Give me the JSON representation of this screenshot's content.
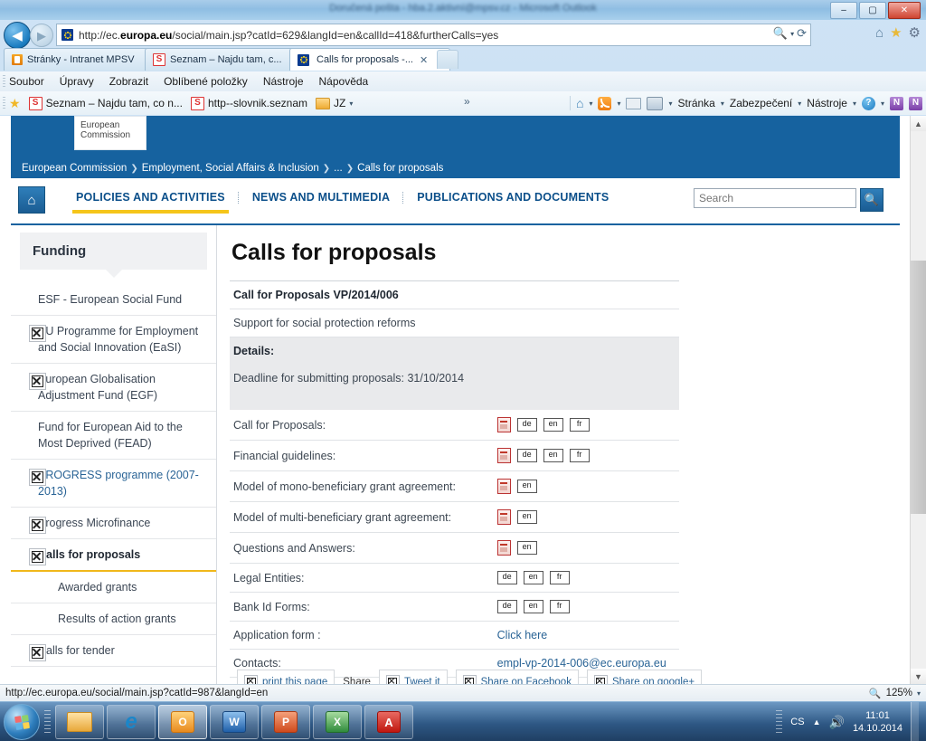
{
  "window": {
    "title": "Doručená pošta - hba.2.aktivní@mpsv.cz - Microsoft Outlook",
    "minimize": "–",
    "maximize": "▢",
    "close": "✕"
  },
  "browser": {
    "back_icon": "back-arrow",
    "forward_icon": "forward-arrow",
    "url": "http://ec.europa.eu/social/main.jsp?catId=629&langId=en&callId=418&furtherCalls=yes",
    "url_prefix": "http://ec.",
    "url_domain": "europa.eu",
    "url_suffix": "/social/main.jsp?catId=629&langId=en&callId=418&furtherCalls=yes",
    "search_addr_icon": "search-icon",
    "refresh_icon": "refresh-icon",
    "home_icon": "home-icon",
    "favorites_icon": "star-icon",
    "settings_icon": "gear-icon",
    "tabs": [
      {
        "label": "Stránky - Intranet MPSV",
        "favicon": "mpsv-icon",
        "active": false
      },
      {
        "label": "Seznam – Najdu tam, c...",
        "favicon": "seznam-icon",
        "active": false
      },
      {
        "label": "Calls for proposals -...",
        "favicon": "eu-icon",
        "active": true,
        "close": "✕"
      }
    ],
    "menus": [
      "Soubor",
      "Úpravy",
      "Zobrazit",
      "Oblíbené položky",
      "Nástroje",
      "Nápověda"
    ],
    "favorites_bar": {
      "star_icon": "star-icon",
      "items": [
        {
          "label": "Seznam – Najdu tam, co n...",
          "icon": "seznam-icon"
        },
        {
          "label": "http--slovnik.seznam",
          "icon": "seznam-icon"
        },
        {
          "label": "JZ",
          "icon": "folder-icon",
          "caret": "▾"
        }
      ],
      "overflow": "»"
    },
    "command_bar": {
      "home_icon": "home-icon",
      "feeds_icon": "rss-icon",
      "mail_icon": "mail-icon",
      "print_icon": "printer-icon",
      "items": [
        "Stránka",
        "Zabezpečení",
        "Nástroje"
      ],
      "help_icon": "help-icon",
      "onenote_icon": "onenote-icon",
      "onenote_linked_icon": "onenote-linked-icon",
      "caret": "▾"
    }
  },
  "site": {
    "logo": {
      "line1": "European",
      "line2": "Commission"
    },
    "breadcrumb": [
      "European Commission",
      "Employment, Social Affairs & Inclusion",
      "...",
      "Calls for proposals"
    ],
    "breadcrumb_sep": "❯",
    "home_icon": "home-icon",
    "nav": [
      {
        "label": "POLICIES AND ACTIVITIES",
        "active": true
      },
      {
        "label": "NEWS AND MULTIMEDIA",
        "active": false
      },
      {
        "label": "PUBLICATIONS AND DOCUMENTS",
        "active": false
      }
    ],
    "search": {
      "placeholder": "Search",
      "value": "",
      "button_icon": "search-icon"
    },
    "accent_blue": "#16629f",
    "accent_yellow": "#f5c51a"
  },
  "sidebar": {
    "heading": "Funding",
    "items": [
      {
        "label": "ESF - European Social Fund",
        "broken_image": false,
        "link": false,
        "current": false,
        "sub": false
      },
      {
        "label": "EU Programme for Employment and Social Innovation (EaSI)",
        "broken_image": true,
        "link": false,
        "current": false,
        "sub": false
      },
      {
        "label": "European Globalisation Adjustment Fund (EGF)",
        "broken_image": true,
        "link": false,
        "current": false,
        "sub": false
      },
      {
        "label": "Fund for European Aid to the Most Deprived (FEAD)",
        "broken_image": false,
        "link": false,
        "current": false,
        "sub": false
      },
      {
        "label": "PROGRESS programme (2007-2013)",
        "broken_image": true,
        "link": true,
        "current": false,
        "sub": false
      },
      {
        "label": "Progress Microfinance",
        "broken_image": true,
        "link": false,
        "current": false,
        "sub": false
      },
      {
        "label": "Calls for proposals",
        "broken_image": true,
        "link": false,
        "current": true,
        "sub": false
      },
      {
        "label": "Awarded grants",
        "broken_image": false,
        "link": false,
        "current": false,
        "sub": true
      },
      {
        "label": "Results of action grants",
        "broken_image": false,
        "link": false,
        "current": false,
        "sub": true
      },
      {
        "label": "Calls for tender",
        "broken_image": true,
        "link": false,
        "current": false,
        "sub": false
      }
    ]
  },
  "main": {
    "title": "Calls for proposals",
    "call_reference": "Call for Proposals VP/2014/006",
    "call_subtitle": "Support for social protection reforms",
    "details_label": "Details:",
    "deadline": "Deadline for submitting proposals: 31/10/2014",
    "rows": [
      {
        "label": "Call for Proposals:",
        "pdf": true,
        "langs": [
          "de",
          "en",
          "fr"
        ],
        "link": null
      },
      {
        "label": "Financial guidelines:",
        "pdf": true,
        "langs": [
          "de",
          "en",
          "fr"
        ],
        "link": null
      },
      {
        "label": "Model of mono-beneficiary grant agreement:",
        "pdf": true,
        "langs": [
          "en"
        ],
        "link": null
      },
      {
        "label": "Model of multi-beneficiary grant agreement:",
        "pdf": true,
        "langs": [
          "en"
        ],
        "link": null
      },
      {
        "label": "Questions and Answers:",
        "pdf": true,
        "langs": [
          "en"
        ],
        "link": null
      },
      {
        "label": "Legal Entities:",
        "pdf": false,
        "langs": [
          "de",
          "en",
          "fr"
        ],
        "link": null
      },
      {
        "label": "Bank Id Forms:",
        "pdf": false,
        "langs": [
          "de",
          "en",
          "fr"
        ],
        "link": null
      },
      {
        "label": "Application form :",
        "pdf": false,
        "langs": [],
        "link": "Click here"
      },
      {
        "label": "Contacts:",
        "pdf": false,
        "langs": [],
        "link": "empl-vp-2014-006@ec.europa.eu"
      }
    ],
    "share": {
      "print_label": "print this page",
      "share_label": "Share",
      "buttons": [
        "Tweet it",
        "Share on Facebook",
        "Share on google+"
      ]
    }
  },
  "statusbar": {
    "url": "http://ec.europa.eu/social/main.jsp?catId=987&langId=en",
    "zoom": "125%",
    "zoom_icon": "magnifier-icon",
    "zoom_caret": "▾"
  },
  "taskbar": {
    "start_icon": "windows-start-icon",
    "buttons": [
      {
        "name": "explorer",
        "icon": "folder-icon"
      },
      {
        "name": "internet-explorer",
        "icon": "ie-icon"
      },
      {
        "name": "outlook",
        "icon": "outlook-icon"
      },
      {
        "name": "word",
        "icon": "word-icon",
        "letter": "W"
      },
      {
        "name": "powerpoint",
        "icon": "powerpoint-icon",
        "letter": "P"
      },
      {
        "name": "excel",
        "icon": "excel-icon",
        "letter": "X"
      },
      {
        "name": "acrobat",
        "icon": "acrobat-icon",
        "letter": "A"
      }
    ],
    "tray": {
      "language": "CS",
      "show_hidden_icon": "▲",
      "volume_icon": "speaker-icon",
      "time": "11:01",
      "date": "14.10.2014"
    }
  }
}
